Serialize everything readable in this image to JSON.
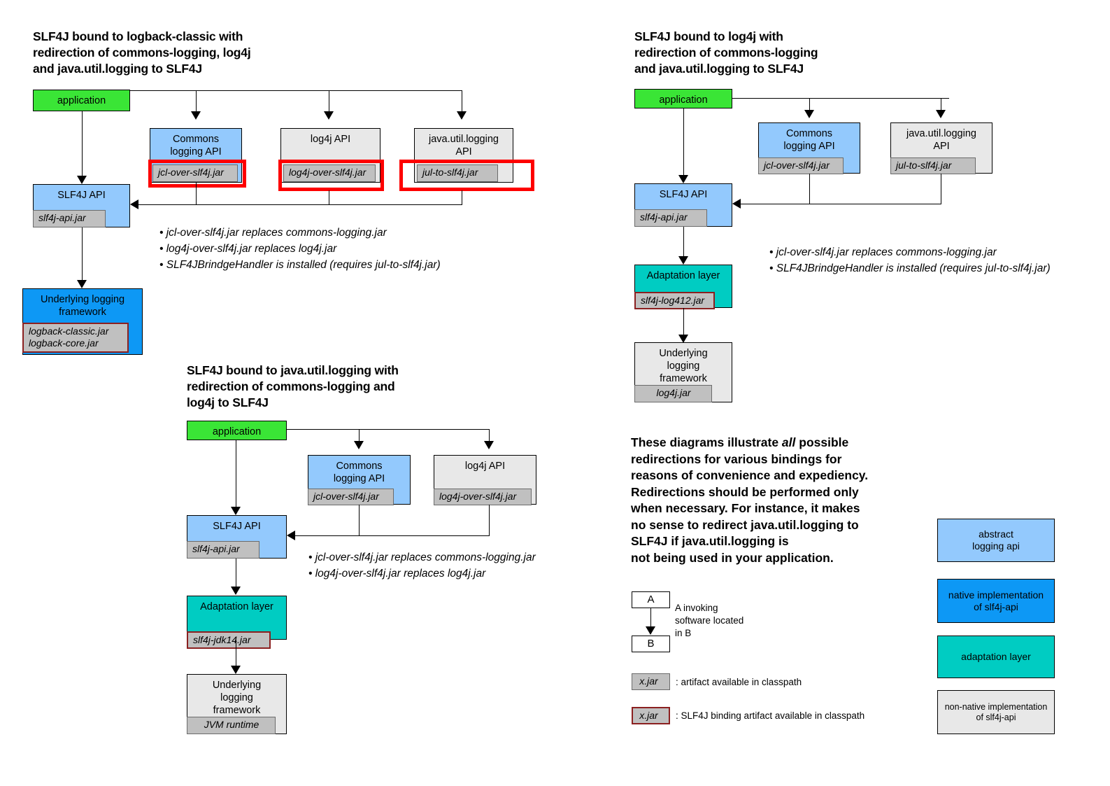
{
  "diagram1": {
    "title": "SLF4J bound to logback-classic with\nredirection of commons-logging, log4j\nand java.util.logging to SLF4J",
    "application": "application",
    "commons": "Commons\nlogging API",
    "commons_jar": "jcl-over-slf4j.jar",
    "log4japi": "log4j API",
    "log4japi_jar": "log4j-over-slf4j.jar",
    "jul": "java.util.logging\nAPI",
    "jul_jar": "jul-to-slf4j.jar",
    "slf4japi": "SLF4J API",
    "slf4japi_jar": "slf4j-api.jar",
    "underlying": "Underlying logging\nframework",
    "underlying_jar": "logback-classic.jar\nlogback-core.jar",
    "bullets": [
      "• jcl-over-slf4j.jar replaces commons-logging.jar",
      "• log4j-over-slf4j.jar replaces log4j.jar",
      "• SLF4JBrindgeHandler is installed (requires jul-to-slf4j.jar)"
    ]
  },
  "diagram2": {
    "title": "SLF4J bound to log4j with\nredirection of commons-logging\nand java.util.logging to SLF4J",
    "application": "application",
    "commons": "Commons\nlogging API",
    "commons_jar": "jcl-over-slf4j.jar",
    "jul": "java.util.logging\nAPI",
    "jul_jar": "jul-to-slf4j.jar",
    "slf4japi": "SLF4J API",
    "slf4japi_jar": "slf4j-api.jar",
    "adaptation": "Adaptation layer",
    "adaptation_jar": "slf4j-log412.jar",
    "underlying": "Underlying\nlogging\nframework",
    "underlying_jar": "log4j.jar",
    "bullets": [
      "• jcl-over-slf4j.jar replaces commons-logging.jar",
      "• SLF4JBrindgeHandler is installed (requires jul-to-slf4j.jar)"
    ]
  },
  "diagram3": {
    "title": "SLF4J bound to java.util.logging with\nredirection of commons-logging and\nlog4j to SLF4J",
    "application": "application",
    "commons": "Commons\nlogging API",
    "commons_jar": "jcl-over-slf4j.jar",
    "log4japi": "log4j API",
    "log4japi_jar": "log4j-over-slf4j.jar",
    "slf4japi": "SLF4J API",
    "slf4japi_jar": "slf4j-api.jar",
    "adaptation": "Adaptation layer",
    "adaptation_jar": "slf4j-jdk14.jar",
    "underlying": "Underlying\nlogging\nframework",
    "underlying_jar": "JVM runtime",
    "bullets": [
      "• jcl-over-slf4j.jar replaces commons-logging.jar",
      "• log4j-over-slf4j.jar replaces log4j.jar"
    ]
  },
  "note": {
    "text": "These diagrams illustrate all possible\nredirections for various bindings for\nreasons of convenience and expediency.\nRedirections should be performed only\nwhen necessary. For instance, it makes\nno sense to redirect java.util.logging to\nSLF4J if java.util.logging is\nnot being used in your application.",
    "emphasis_word": "all"
  },
  "legend": {
    "box_a": "A",
    "box_b": "B",
    "arrow_caption": "A invoking\nsoftware located\nin B",
    "jar_plain": "x.jar",
    "jar_plain_caption": ": artifact available in classpath",
    "jar_binding": "x.jar",
    "jar_binding_caption": ": SLF4J binding artifact available in classpath",
    "swatches": [
      {
        "label": "abstract\nlogging api",
        "color": "#93c9fd"
      },
      {
        "label": "native implementation\nof slf4j-api",
        "color": "#0d98f5"
      },
      {
        "label": "adaptation layer",
        "color": "#00ccc2"
      },
      {
        "label": "non-native implementation\nof slf4j-api",
        "color": "#e8e8e8"
      }
    ]
  },
  "colors": {
    "application_green": "#3ae536",
    "abstract_blue": "#93c9fd",
    "native_blue": "#0d98f5",
    "adaptation_teal": "#00ccc2",
    "nonnative_grey": "#e8e8e8",
    "jar_grey": "#c0c0c0",
    "binding_border": "#8b2020",
    "highlight_red": "#fe0000"
  }
}
